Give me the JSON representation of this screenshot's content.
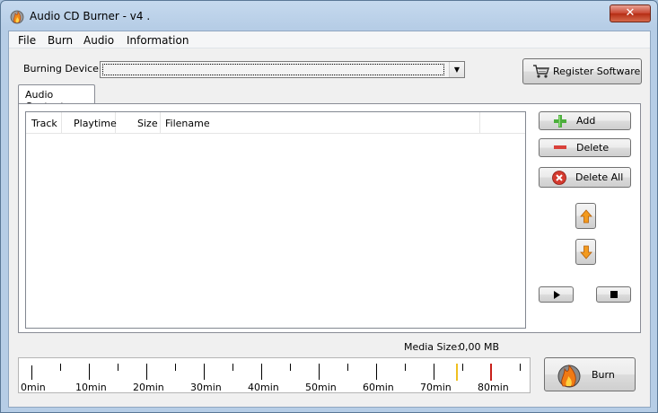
{
  "window": {
    "title": "Audio CD Burner - v4 .",
    "close_label": "✕"
  },
  "menu": [
    "File",
    "Burn",
    "Audio",
    "Information"
  ],
  "device": {
    "label": "Burning Device:",
    "value": ""
  },
  "register_button": "Register Software",
  "tab_label": "Audio Content",
  "columns": [
    "Track",
    "Playtime",
    "Size",
    "Filename"
  ],
  "buttons": {
    "add": "Add",
    "delete": "Delete",
    "delete_all": "Delete All",
    "burn": "Burn"
  },
  "media_size": {
    "label": "Media Size:",
    "value": "0,00 MB"
  },
  "ruler": {
    "labels": [
      "0min",
      "10min",
      "20min",
      "30min",
      "40min",
      "50min",
      "60min",
      "70min",
      "80min"
    ],
    "yellow_marker_min": 74,
    "red_marker_min": 80
  },
  "colors": {
    "accent_yellow": "#f0c020",
    "accent_red": "#c8201a",
    "add_green": "#3aa83a",
    "delete_red": "#d9413a"
  }
}
